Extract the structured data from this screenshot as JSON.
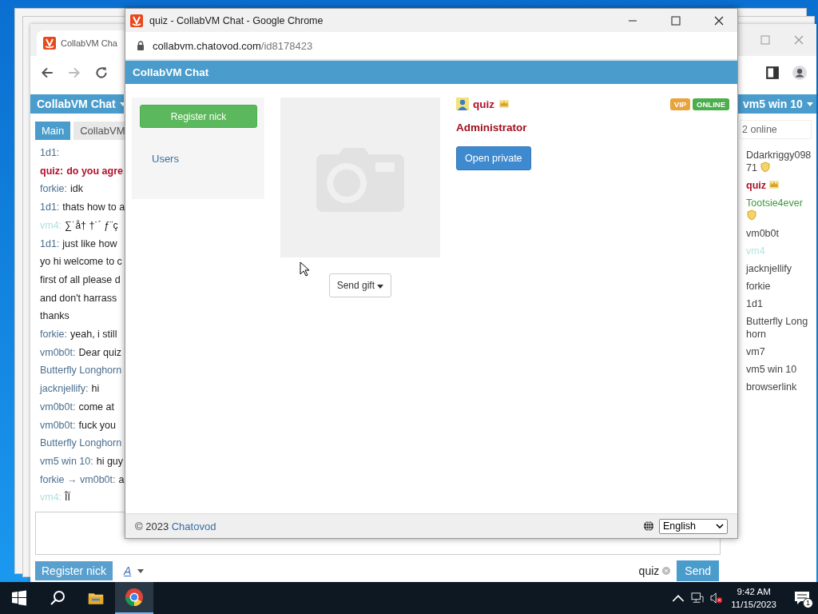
{
  "back_window": {
    "tab_title": "CollabVM Cha",
    "chat_header": "CollabVM Chat",
    "tabs": [
      {
        "label": "Main",
        "selected": true
      },
      {
        "label": "CollabVM",
        "selected": false
      }
    ],
    "messages": [
      {
        "kind": "chat",
        "sender": "1d1:",
        "color": "#4a6f8f"
      },
      {
        "kind": "admin",
        "sender": "quiz:",
        "text": "do you agre",
        "color": "#b0102a"
      },
      {
        "kind": "chat",
        "sender": "forkie:",
        "text": "idk",
        "color": "#4a6f8f"
      },
      {
        "kind": "chat",
        "sender": "1d1:",
        "text": "thats how to a",
        "color": "#4a6f8f"
      },
      {
        "kind": "chat",
        "sender": "vm4:",
        "text": "∑˙å† †˙´ ƒ¨ç",
        "color": "#b5dede"
      },
      {
        "kind": "chat",
        "sender": "1d1:",
        "text": "just like how",
        "color": "#4a6f8f"
      },
      {
        "kind": "line",
        "text": "yo hi welcome to c"
      },
      {
        "kind": "line",
        "text": "first of all please d"
      },
      {
        "kind": "line",
        "text": "and don't harrass"
      },
      {
        "kind": "line",
        "text": "thanks"
      },
      {
        "kind": "chat",
        "sender": "forkie:",
        "text": "yeah, i still",
        "color": "#4a6f8f"
      },
      {
        "kind": "chat",
        "sender": "vm0b0t:",
        "text": "Dear quiz",
        "color": "#4a6f8f"
      },
      {
        "kind": "chat",
        "sender": "Butterfly Longhorn",
        "color": "#4a6f8f"
      },
      {
        "kind": "chat",
        "sender": "jacknjellify:",
        "text": "hi",
        "color": "#4a6f8f"
      },
      {
        "kind": "chat",
        "sender": "vm0b0t:",
        "text": "come at",
        "color": "#4a6f8f"
      },
      {
        "kind": "chat",
        "sender": "vm0b0t:",
        "text": "fuck you",
        "color": "#4a6f8f"
      },
      {
        "kind": "chat",
        "sender": "Butterfly Longhorn",
        "color": "#4a6f8f"
      },
      {
        "kind": "chat",
        "sender": "vm5 win 10:",
        "text": "hi guy",
        "color": "#4a6f8f"
      },
      {
        "kind": "chat",
        "sender": "forkie → vm0b0t:",
        "text": "a",
        "color": "#4a6f8f"
      },
      {
        "kind": "chat",
        "sender": "vm4:",
        "text": "ÎÏ",
        "color": "#b5dede"
      }
    ],
    "room_header": "vm5 win 10",
    "user_search": {
      "placeholder": "2 online"
    },
    "users": [
      {
        "name": "Ddarkriggy09871",
        "color": "#444444",
        "shield": true,
        "crown": false
      },
      {
        "name": "quiz",
        "color": "#b0102a",
        "shield": false,
        "crown": true
      },
      {
        "name": "Tootsie4ever",
        "color": "#3a9a3a",
        "shield": true,
        "crown": false
      },
      {
        "name": "vm0b0t",
        "color": "#444444",
        "shield": false,
        "crown": false
      },
      {
        "name": "vm4",
        "color": "#b5e3e3",
        "shield": false,
        "crown": false
      },
      {
        "name": "jacknjellify",
        "color": "#444444",
        "shield": false,
        "crown": false
      },
      {
        "name": "forkie",
        "color": "#444444",
        "shield": false,
        "crown": false
      },
      {
        "name": "1d1",
        "color": "#444444",
        "shield": false,
        "crown": false
      },
      {
        "name": "Butterfly Longhorn",
        "color": "#444444",
        "shield": false,
        "crown": false
      },
      {
        "name": "vm7",
        "color": "#444444",
        "shield": false,
        "crown": false
      },
      {
        "name": "vm5 win 10",
        "color": "#444444",
        "shield": false,
        "crown": false
      },
      {
        "name": "browserlink",
        "color": "#444444",
        "shield": false,
        "crown": false
      }
    ],
    "register_button": "Register nick",
    "format_label": "A",
    "nick": "quiz",
    "send_button": "Send"
  },
  "popup": {
    "title": "quiz - CollabVM Chat - Google Chrome",
    "url_domain": "collabvm.chatovod.com",
    "url_path": "/id8178423",
    "header": "CollabVM Chat",
    "register_button": "Register nick",
    "users_link": "Users",
    "send_gift": "Send gift",
    "profile": {
      "name": "quiz",
      "role": "Administrator",
      "open_private": "Open private",
      "badges": [
        {
          "label": "VIP",
          "color": "#e8a33d"
        },
        {
          "label": "ONLINE",
          "color": "#4cae4c"
        }
      ]
    },
    "footer": {
      "copyright": "© 2023",
      "link": "Chatovod",
      "language": "English"
    }
  },
  "taskbar": {
    "time": "9:42 AM",
    "date": "11/15/2023",
    "notifications": "1"
  }
}
